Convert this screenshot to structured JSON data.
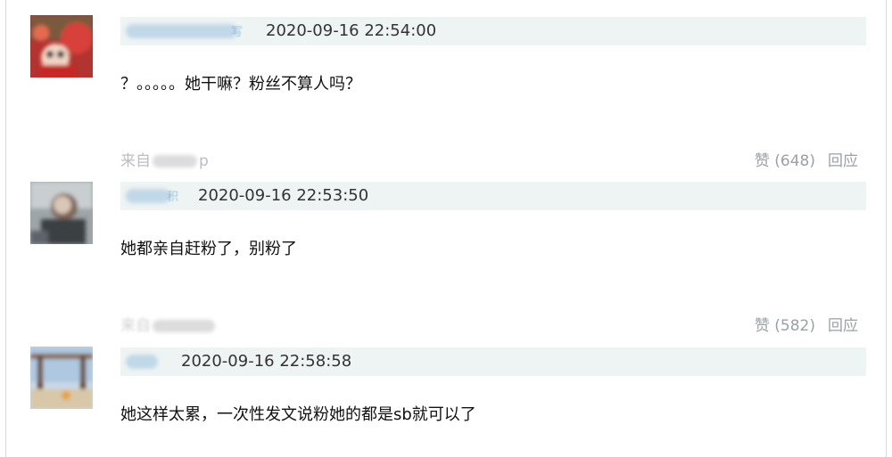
{
  "comments": [
    {
      "username_tail": "写",
      "timestamp": "2020-09-16 22:54:00",
      "content": "？。。。。。她干嘛？粉丝不算人吗？",
      "source_prefix": "来自",
      "source_tail": "p",
      "like_label": "赞 (648)",
      "reply_label": "回应"
    },
    {
      "username_tail": "积",
      "timestamp": "2020-09-16 22:53:50",
      "content": "她都亲自赶粉了，别粉了",
      "source_prefix": "来自",
      "source_tail": "",
      "like_label": "赞 (582)",
      "reply_label": "回应"
    },
    {
      "username_tail": "",
      "timestamp": "2020-09-16 22:58:58",
      "content": "她这样太累，一次性发文说粉她的都是sb就可以了"
    }
  ],
  "colors": {
    "meta_bar_bg": "#eef3f3",
    "source_text": "#bdbdbd",
    "action_text": "#9aa0a6"
  }
}
